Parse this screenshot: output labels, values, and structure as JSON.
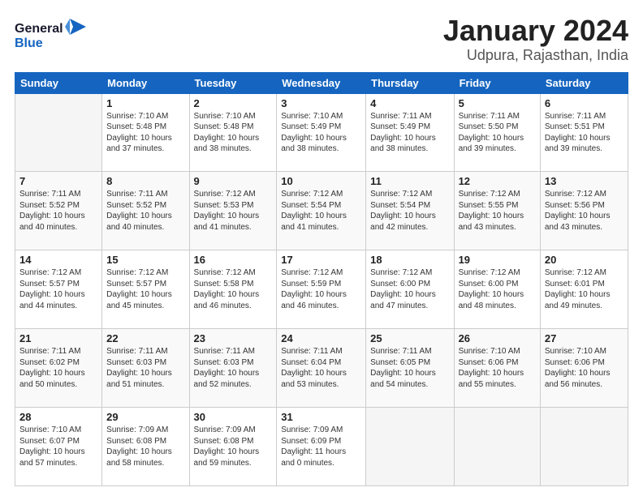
{
  "logo": {
    "general": "General",
    "blue": "Blue"
  },
  "title": "January 2024",
  "subtitle": "Udpura, Rajasthan, India",
  "days_of_week": [
    "Sunday",
    "Monday",
    "Tuesday",
    "Wednesday",
    "Thursday",
    "Friday",
    "Saturday"
  ],
  "weeks": [
    [
      {
        "day": "",
        "info": ""
      },
      {
        "day": "1",
        "info": "Sunrise: 7:10 AM\nSunset: 5:48 PM\nDaylight: 10 hours\nand 37 minutes."
      },
      {
        "day": "2",
        "info": "Sunrise: 7:10 AM\nSunset: 5:48 PM\nDaylight: 10 hours\nand 38 minutes."
      },
      {
        "day": "3",
        "info": "Sunrise: 7:10 AM\nSunset: 5:49 PM\nDaylight: 10 hours\nand 38 minutes."
      },
      {
        "day": "4",
        "info": "Sunrise: 7:11 AM\nSunset: 5:49 PM\nDaylight: 10 hours\nand 38 minutes."
      },
      {
        "day": "5",
        "info": "Sunrise: 7:11 AM\nSunset: 5:50 PM\nDaylight: 10 hours\nand 39 minutes."
      },
      {
        "day": "6",
        "info": "Sunrise: 7:11 AM\nSunset: 5:51 PM\nDaylight: 10 hours\nand 39 minutes."
      }
    ],
    [
      {
        "day": "7",
        "info": "Sunrise: 7:11 AM\nSunset: 5:52 PM\nDaylight: 10 hours\nand 40 minutes."
      },
      {
        "day": "8",
        "info": "Sunrise: 7:11 AM\nSunset: 5:52 PM\nDaylight: 10 hours\nand 40 minutes."
      },
      {
        "day": "9",
        "info": "Sunrise: 7:12 AM\nSunset: 5:53 PM\nDaylight: 10 hours\nand 41 minutes."
      },
      {
        "day": "10",
        "info": "Sunrise: 7:12 AM\nSunset: 5:54 PM\nDaylight: 10 hours\nand 41 minutes."
      },
      {
        "day": "11",
        "info": "Sunrise: 7:12 AM\nSunset: 5:54 PM\nDaylight: 10 hours\nand 42 minutes."
      },
      {
        "day": "12",
        "info": "Sunrise: 7:12 AM\nSunset: 5:55 PM\nDaylight: 10 hours\nand 43 minutes."
      },
      {
        "day": "13",
        "info": "Sunrise: 7:12 AM\nSunset: 5:56 PM\nDaylight: 10 hours\nand 43 minutes."
      }
    ],
    [
      {
        "day": "14",
        "info": "Sunrise: 7:12 AM\nSunset: 5:57 PM\nDaylight: 10 hours\nand 44 minutes."
      },
      {
        "day": "15",
        "info": "Sunrise: 7:12 AM\nSunset: 5:57 PM\nDaylight: 10 hours\nand 45 minutes."
      },
      {
        "day": "16",
        "info": "Sunrise: 7:12 AM\nSunset: 5:58 PM\nDaylight: 10 hours\nand 46 minutes."
      },
      {
        "day": "17",
        "info": "Sunrise: 7:12 AM\nSunset: 5:59 PM\nDaylight: 10 hours\nand 46 minutes."
      },
      {
        "day": "18",
        "info": "Sunrise: 7:12 AM\nSunset: 6:00 PM\nDaylight: 10 hours\nand 47 minutes."
      },
      {
        "day": "19",
        "info": "Sunrise: 7:12 AM\nSunset: 6:00 PM\nDaylight: 10 hours\nand 48 minutes."
      },
      {
        "day": "20",
        "info": "Sunrise: 7:12 AM\nSunset: 6:01 PM\nDaylight: 10 hours\nand 49 minutes."
      }
    ],
    [
      {
        "day": "21",
        "info": "Sunrise: 7:11 AM\nSunset: 6:02 PM\nDaylight: 10 hours\nand 50 minutes."
      },
      {
        "day": "22",
        "info": "Sunrise: 7:11 AM\nSunset: 6:03 PM\nDaylight: 10 hours\nand 51 minutes."
      },
      {
        "day": "23",
        "info": "Sunrise: 7:11 AM\nSunset: 6:03 PM\nDaylight: 10 hours\nand 52 minutes."
      },
      {
        "day": "24",
        "info": "Sunrise: 7:11 AM\nSunset: 6:04 PM\nDaylight: 10 hours\nand 53 minutes."
      },
      {
        "day": "25",
        "info": "Sunrise: 7:11 AM\nSunset: 6:05 PM\nDaylight: 10 hours\nand 54 minutes."
      },
      {
        "day": "26",
        "info": "Sunrise: 7:10 AM\nSunset: 6:06 PM\nDaylight: 10 hours\nand 55 minutes."
      },
      {
        "day": "27",
        "info": "Sunrise: 7:10 AM\nSunset: 6:06 PM\nDaylight: 10 hours\nand 56 minutes."
      }
    ],
    [
      {
        "day": "28",
        "info": "Sunrise: 7:10 AM\nSunset: 6:07 PM\nDaylight: 10 hours\nand 57 minutes."
      },
      {
        "day": "29",
        "info": "Sunrise: 7:09 AM\nSunset: 6:08 PM\nDaylight: 10 hours\nand 58 minutes."
      },
      {
        "day": "30",
        "info": "Sunrise: 7:09 AM\nSunset: 6:08 PM\nDaylight: 10 hours\nand 59 minutes."
      },
      {
        "day": "31",
        "info": "Sunrise: 7:09 AM\nSunset: 6:09 PM\nDaylight: 11 hours\nand 0 minutes."
      },
      {
        "day": "",
        "info": ""
      },
      {
        "day": "",
        "info": ""
      },
      {
        "day": "",
        "info": ""
      }
    ]
  ]
}
